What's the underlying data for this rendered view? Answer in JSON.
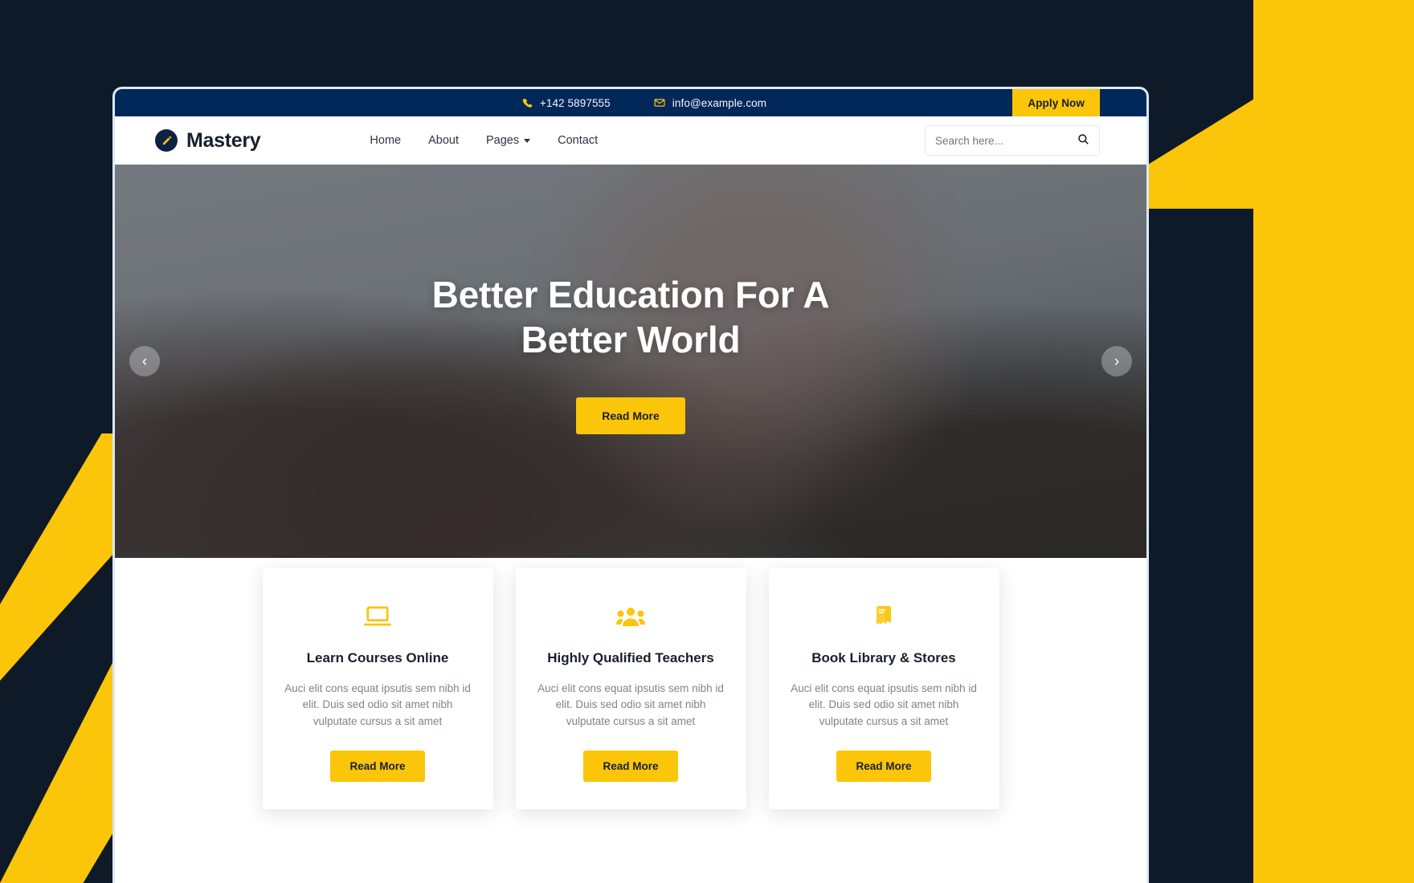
{
  "site": {
    "brand_name": "Mastery",
    "brand_icon": "pencil-square-icon",
    "accent_color": "#fbc50a",
    "navy_color": "#022859",
    "dark_bg_color": "#0e1a28"
  },
  "topbar": {
    "phone_icon": "phone-icon",
    "phone": "+142 5897555",
    "email_icon": "envelope-icon",
    "email": "info@example.com",
    "apply_label": "Apply Now"
  },
  "nav": {
    "links": [
      {
        "label": "Home",
        "has_dropdown": false
      },
      {
        "label": "About",
        "has_dropdown": false
      },
      {
        "label": "Pages",
        "has_dropdown": true
      },
      {
        "label": "Contact",
        "has_dropdown": false
      }
    ],
    "search": {
      "placeholder": "Search here...",
      "value": "",
      "icon": "search-icon"
    }
  },
  "hero": {
    "title_line1": "Better Education For A",
    "title_line2": "Better World",
    "button_label": "Read More",
    "prev_icon": "chevron-left-icon",
    "next_icon": "chevron-right-icon"
  },
  "cards": [
    {
      "icon": "laptop-icon",
      "title": "Learn Courses Online",
      "text": "Auci elit cons equat ipsutis sem nibh id elit. Duis sed odio sit amet nibh vulputate cursus a sit amet",
      "button_label": "Read More"
    },
    {
      "icon": "users-group-icon",
      "title": "Highly Qualified Teachers",
      "text": "Auci elit cons equat ipsutis sem nibh id elit. Duis sed odio sit amet nibh vulputate cursus a sit amet",
      "button_label": "Read More"
    },
    {
      "icon": "book-icon",
      "title": "Book Library & Stores",
      "text": "Auci elit cons equat ipsutis sem nibh id elit. Duis sed odio sit amet nibh vulputate cursus a sit amet",
      "button_label": "Read More"
    }
  ]
}
